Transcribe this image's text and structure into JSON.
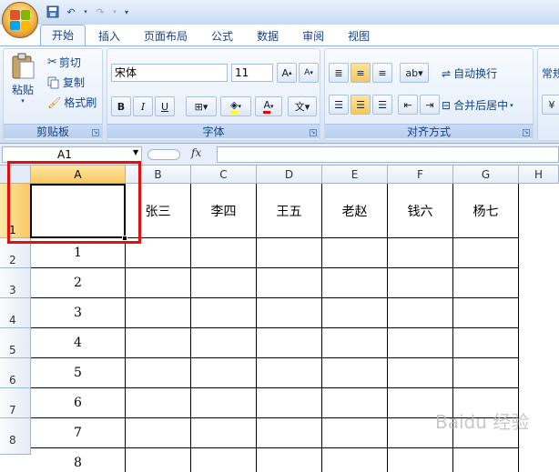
{
  "qat": {
    "undo_label": "↶",
    "redo_label": "↷"
  },
  "tabs": [
    "开始",
    "插入",
    "页面布局",
    "公式",
    "数据",
    "审阅",
    "视图"
  ],
  "clipboard": {
    "paste": "粘贴",
    "cut": "剪切",
    "copy": "复制",
    "format_painter": "格式刷",
    "group": "剪贴板"
  },
  "font": {
    "name": "宋体",
    "size": "11",
    "bold": "B",
    "italic": "I",
    "underline": "U",
    "group": "字体"
  },
  "alignment": {
    "wrap": "自动换行",
    "merge": "合并后居中",
    "group": "对齐方式"
  },
  "number": {
    "format": "常规"
  },
  "formula_bar": {
    "name_box": "A1",
    "fx": "fx"
  },
  "columns": [
    "A",
    "B",
    "C",
    "D",
    "E",
    "F",
    "G",
    "H"
  ],
  "rows": [
    "1",
    "2",
    "3",
    "4",
    "5",
    "6",
    "7",
    "8"
  ],
  "header_row": [
    "",
    "张三",
    "李四",
    "王五",
    "老赵",
    "钱六",
    "杨七"
  ],
  "col_a_values": [
    "1",
    "2",
    "3",
    "4",
    "5",
    "6",
    "7",
    "8"
  ],
  "watermark": "Baidu 经验",
  "colors": {
    "selection_outline": "#e60d0d",
    "ribbon_bg": "#dfeaf8"
  }
}
